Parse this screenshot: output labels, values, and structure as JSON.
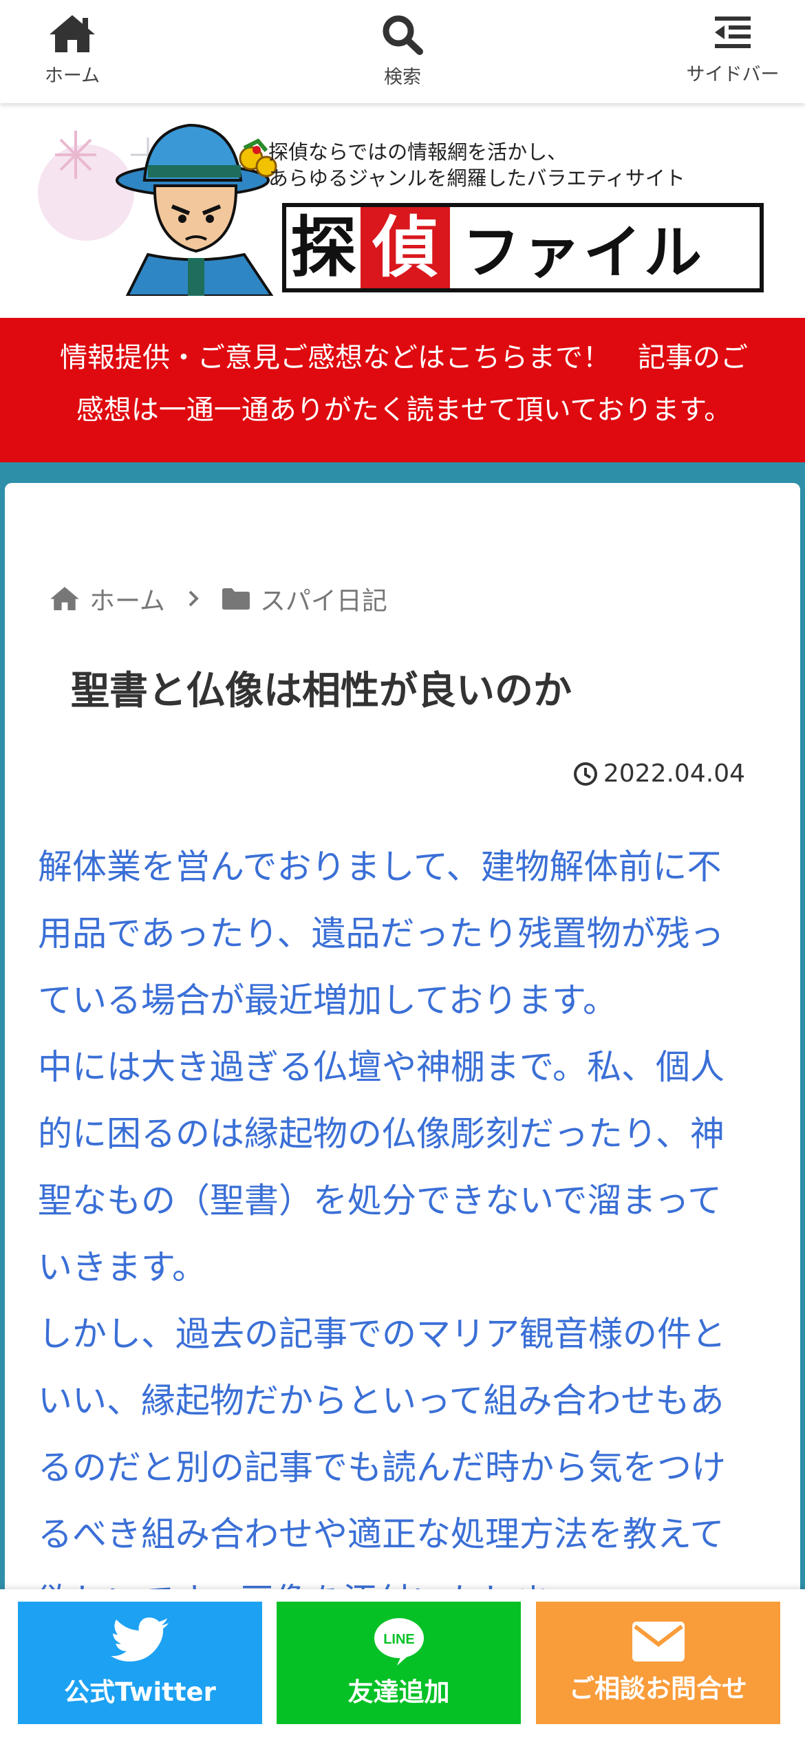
{
  "nav": {
    "home_label": "ホーム",
    "search_label": "検索",
    "sidebar_label": "サイドバー"
  },
  "header": {
    "tagline_line1": "探偵ならではの情報網を活かし、",
    "tagline_line2": "あらゆるジャンルを網羅したバラエティサイト",
    "logo_char1": "探",
    "logo_char2": "偵",
    "logo_kana": "ファイル"
  },
  "notice": {
    "line1": "情報提供・ご意見ご感想などはこちらまで！　記事のご",
    "line2": "感想は一通一通ありがたく読ませて頂いております。"
  },
  "breadcrumb": {
    "home": "ホーム",
    "category": "スパイ日記"
  },
  "article": {
    "title": "聖書と仏像は相性が良いのか",
    "date": "2022.04.04",
    "paragraphs": [
      "解体業を営んでおりまして、建物解体前に不用品であったり、遺品だったり残置物が残っている場合が最近増加しております。",
      "中には大き過ぎる仏壇や神棚まで。私、個人的に困るのは縁起物の仏像彫刻だったり、神聖なもの（聖書）を処分できないで溜まっていきます。",
      "しかし、過去の記事でのマリア観音様の件といい、縁起物だからといって組み合わせもあるのだと別の記事でも読んだ時から気をつけるべき組み合わせや適正な処理方法を教えて欲しいです。画像を添付いたしま"
    ]
  },
  "bottom_buttons": {
    "twitter": "公式Twitter",
    "line": "友達追加",
    "line_badge": "LINE",
    "contact": "ご相談お問合せ"
  },
  "colors": {
    "page_bg": "#2e8fa8",
    "notice_bg": "#df0a0f",
    "body_text": "#3a6fd6",
    "twitter": "#1da1f2",
    "line": "#06c126",
    "contact": "#f99c3a"
  }
}
